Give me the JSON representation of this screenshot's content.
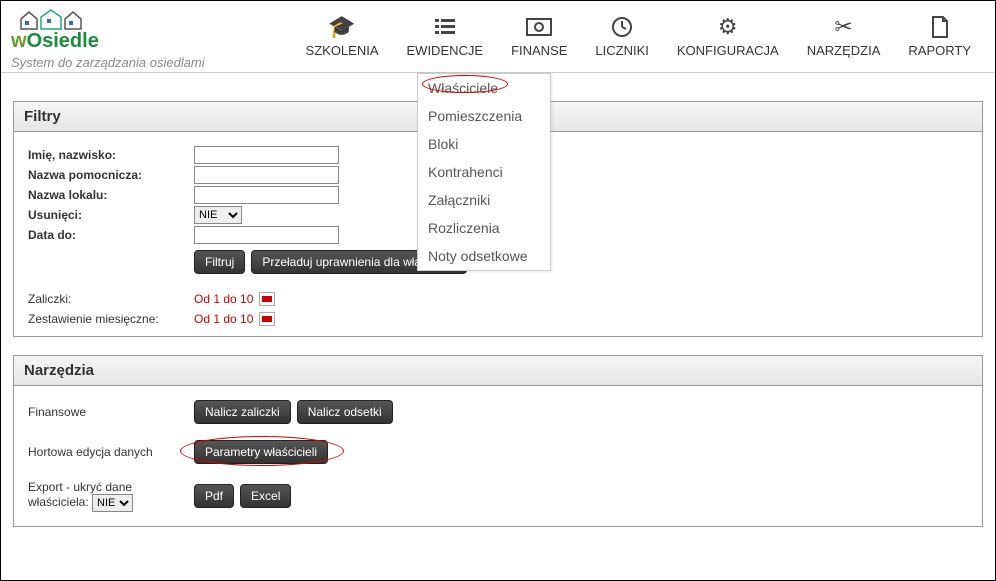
{
  "logo": {
    "name_part1": "w",
    "name_part2": "Osiedle",
    "tagline": "System do zarządzania osiedlami"
  },
  "nav": {
    "items": [
      {
        "label": "SZKOLENIA",
        "icon": "graduation"
      },
      {
        "label": "EWIDENCJE",
        "icon": "list"
      },
      {
        "label": "FINANSE",
        "icon": "money"
      },
      {
        "label": "LICZNIKI",
        "icon": "clock"
      },
      {
        "label": "KONFIGURACJA",
        "icon": "gear"
      },
      {
        "label": "NARZĘDZIA",
        "icon": "scissors"
      },
      {
        "label": "RAPORTY",
        "icon": "document"
      }
    ]
  },
  "dropdown": {
    "items": [
      {
        "label": "Właściciele",
        "highlighted": true
      },
      {
        "label": "Pomieszczenia"
      },
      {
        "label": "Bloki"
      },
      {
        "label": "Kontrahenci"
      },
      {
        "label": "Załączniki"
      },
      {
        "label": "Rozliczenia"
      },
      {
        "label": "Noty odsetkowe"
      }
    ]
  },
  "filters_panel": {
    "title": "Filtry",
    "fields": {
      "name_label": "Imię, nazwisko:",
      "aux_name_label": "Nazwa pomocnicza:",
      "local_name_label": "Nazwa lokalu:",
      "deleted_label": "Usunięci:",
      "deleted_value": "NIE",
      "date_to_label": "Data do:"
    },
    "buttons": {
      "filter": "Filtruj",
      "reload": "Przeładuj uprawnienia dla właścicieli"
    },
    "zaliczki_label": "Zaliczki:",
    "zaliczki_link": "Od 1 do 10",
    "zestawienie_label": "Zestawienie miesięczne:",
    "zestawienie_link": "Od 1 do 10"
  },
  "tools_panel": {
    "title": "Narzędzia",
    "finansowe_label": "Finansowe",
    "nalicz_zaliczki": "Nalicz zaliczki",
    "nalicz_odsetki": "Nalicz odsetki",
    "hortowa_label": "Hortowa edycja danych",
    "parametry_btn": "Parametry właścicieli",
    "export_label": "Export - ukryć dane właściciela:",
    "export_select": "NIE",
    "pdf_btn": "Pdf",
    "excel_btn": "Excel"
  }
}
